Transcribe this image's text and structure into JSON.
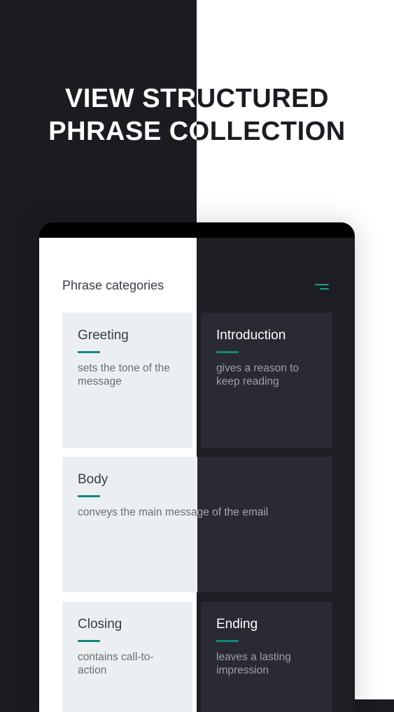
{
  "promo": {
    "headline_line1": "VIEW STRUCTURED",
    "headline_line2": "PHRASE COLLECTION"
  },
  "screen": {
    "title": "Phrase categories",
    "menu_icon": "menu-icon"
  },
  "colors": {
    "accent": "#12897a",
    "dark_bg": "#1b1b21",
    "light_card": "#eceff2",
    "dark_card": "#292a33"
  },
  "categories": [
    {
      "title": "Greeting",
      "description": "sets the tone of the message"
    },
    {
      "title": "Introduction",
      "description": "gives a reason to keep reading"
    },
    {
      "title": "Body",
      "description": "conveys the main message of the email"
    },
    {
      "title": "Closing",
      "description": "contains call-to-action"
    },
    {
      "title": "Ending",
      "description": "leaves a lasting impression"
    }
  ]
}
